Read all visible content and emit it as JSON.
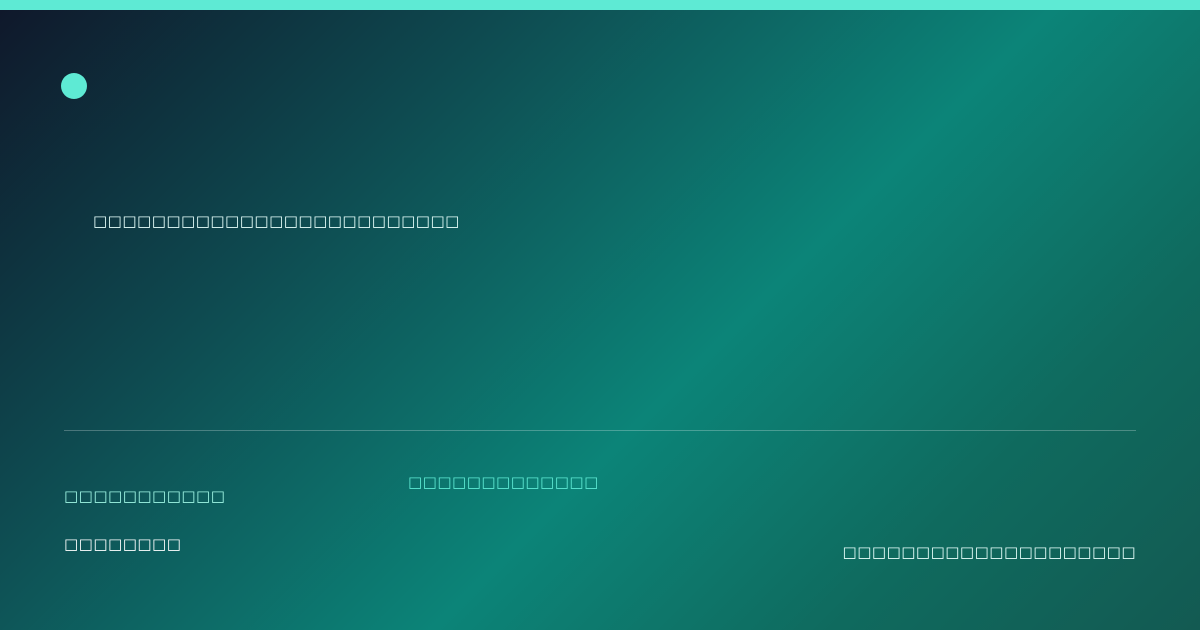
{
  "headline": "□□□□□□□□□□□□□□□□□□□□□□□□□",
  "footer": {
    "label": "□□□□□□□□□□□",
    "value": "□□□□□□□□",
    "center_tag": "□□□□□□□□□□□□□",
    "right_note": "□□□□□□□□□□□□□□□□□□□□"
  },
  "colors": {
    "accent": "#5eead4",
    "background_dark": "#0f172a",
    "background_teal": "#0c8478"
  }
}
